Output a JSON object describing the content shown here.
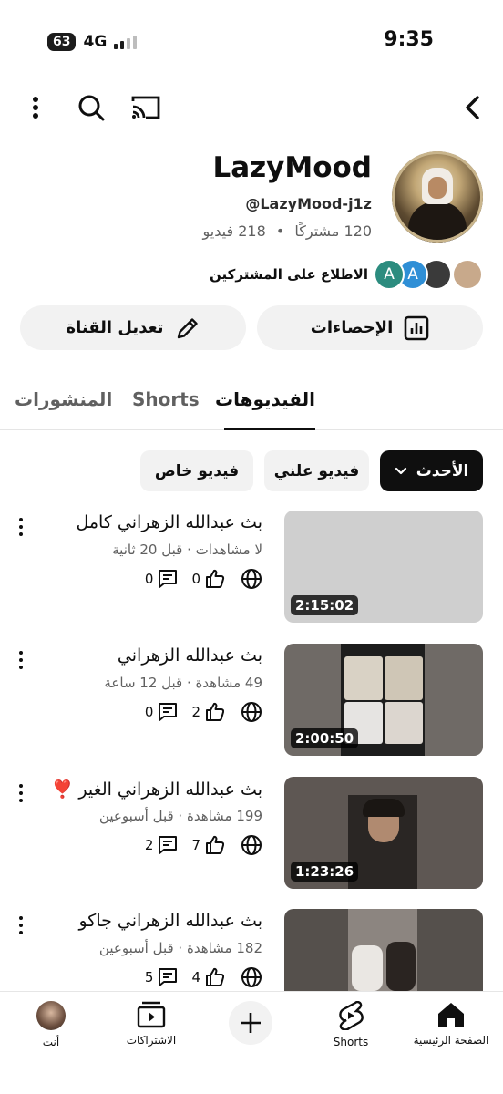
{
  "status": {
    "battery": "63",
    "network": "4G",
    "time": "9:35"
  },
  "channel": {
    "name": "LazyMood",
    "handle": "@LazyMood-j1z",
    "subscribers": "120 مشتركًا",
    "separator": "•",
    "videos_count": "218 فيديو",
    "view_subscribers": "الاطلاع على المشتركين",
    "subscriber_avatars": [
      {
        "letter": "",
        "color": "#c8a98b"
      },
      {
        "letter": "",
        "color": "#3a3a3a"
      },
      {
        "letter": "A",
        "color": "#2f8fd6"
      },
      {
        "letter": "A",
        "color": "#2c8c7f"
      }
    ]
  },
  "buttons": {
    "analytics": "الإحصاءات",
    "edit_channel": "تعديل القناة"
  },
  "tabs": [
    "الفيديوهات",
    "Shorts",
    "المنشورات"
  ],
  "chips": {
    "latest": "الأحدث",
    "public": "فيديو علني",
    "private": "فيديو خاص"
  },
  "videos": [
    {
      "title": "بث عبدالله الزهراني كامل",
      "meta": "لا مشاهدات · قبل 20 ثانية",
      "likes": "0",
      "comments": "0",
      "duration": "2:15:02"
    },
    {
      "title": "بث عبدالله الزهراني",
      "meta": "49 مشاهدة · قبل 12 ساعة",
      "likes": "2",
      "comments": "0",
      "duration": "2:00:50"
    },
    {
      "title": "بث عبدالله الزهراني الغير ❣️",
      "meta": "199 مشاهدة · قبل أسبوعين",
      "likes": "7",
      "comments": "2",
      "duration": "1:23:26"
    },
    {
      "title": "بث عبدالله الزهراني جاكو",
      "meta": "182 مشاهدة · قبل أسبوعين",
      "likes": "4",
      "comments": "5",
      "duration": ""
    }
  ],
  "nav": {
    "home": "الصفحة الرئيسية",
    "shorts": "Shorts",
    "subscriptions": "الاشتراكات",
    "you": "أنت"
  },
  "colors": {
    "text": "#0f0f0f",
    "secondary": "#606060",
    "chip_bg": "#f2f2f2",
    "dark_chip": "#0f0f0f"
  }
}
